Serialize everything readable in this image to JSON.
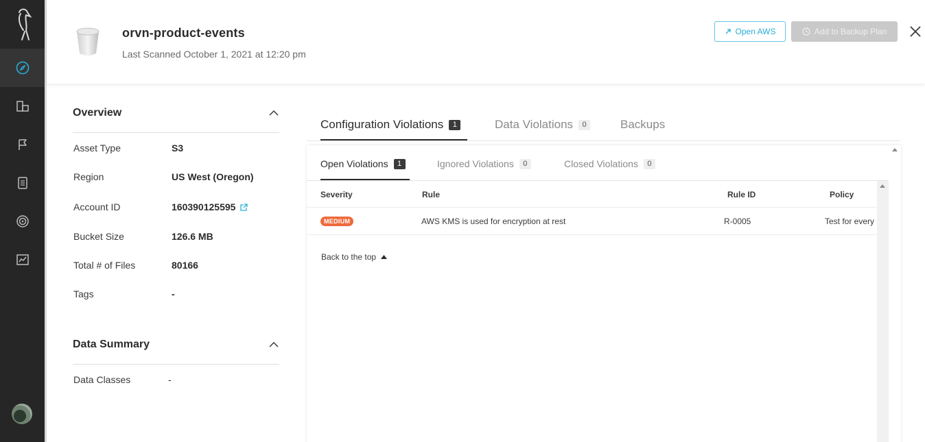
{
  "header": {
    "asset_title": "orvn-product-events",
    "last_scanned": "Last Scanned October 1, 2021 at 12:20 pm",
    "open_aws_label": "Open AWS",
    "add_backup_label": "Add to Backup Plan"
  },
  "sidebar": {
    "items": [
      {
        "icon": "compass-icon",
        "active": true
      },
      {
        "icon": "inventory-icon",
        "active": false
      },
      {
        "icon": "flag-icon",
        "active": false
      },
      {
        "icon": "document-icon",
        "active": false
      },
      {
        "icon": "target-icon",
        "active": false
      },
      {
        "icon": "chart-icon",
        "active": false
      }
    ]
  },
  "overview": {
    "title": "Overview",
    "rows": [
      {
        "label": "Asset Type",
        "value": "S3"
      },
      {
        "label": "Region",
        "value": "US West (Oregon)"
      },
      {
        "label": "Account ID",
        "value": "160390125595"
      },
      {
        "label": "Bucket Size",
        "value": "126.6 MB"
      },
      {
        "label": "Total # of Files",
        "value": "80166"
      },
      {
        "label": "Tags",
        "value": "-"
      }
    ]
  },
  "data_summary": {
    "title": "Data Summary",
    "rows": [
      {
        "label": "Data Classes",
        "value": "-"
      }
    ]
  },
  "tabs": [
    {
      "label": "Configuration Violations",
      "count": "1"
    },
    {
      "label": "Data Violations",
      "count": "0"
    },
    {
      "label": "Backups",
      "count": ""
    }
  ],
  "sub_tabs": [
    {
      "label": "Open Violations",
      "count": "1"
    },
    {
      "label": "Ignored Violations",
      "count": "0"
    },
    {
      "label": "Closed Violations",
      "count": "0"
    }
  ],
  "table": {
    "columns": [
      "Severity",
      "Rule",
      "Rule ID",
      "Policy"
    ],
    "rows": [
      {
        "severity": "MEDIUM",
        "rule": "AWS KMS is used for encryption at rest",
        "rule_id": "R-0005",
        "policy": "Test for every"
      }
    ]
  },
  "back_to_top": "Back to the top",
  "colors": {
    "sidebar": "#262626",
    "accent": "#2aaed6",
    "severity_medium": "#ef6a3c"
  }
}
